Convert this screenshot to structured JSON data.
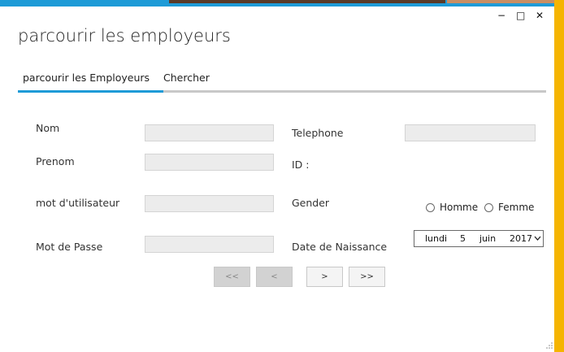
{
  "window": {
    "title": "parcourir les employeurs",
    "minimize": "−",
    "maximize": "□",
    "close": "✕"
  },
  "tabs": [
    {
      "label": "parcourir les Employeurs",
      "active": true
    },
    {
      "label": "Chercher",
      "active": false
    }
  ],
  "form": {
    "nom_label": "Nom",
    "prenom_label": "Prenom",
    "username_label": "mot d'utilisateur",
    "password_label": "Mot de Passe",
    "telephone_label": "Telephone",
    "id_label": "ID :",
    "gender_label": "Gender",
    "gender_options": [
      "Homme",
      "Femme"
    ],
    "birthdate_label": "Date de Naissance",
    "birthdate": {
      "weekday": "lundi",
      "day": "5",
      "month": "juin",
      "year": "2017"
    },
    "nom_value": "",
    "prenom_value": "",
    "username_value": "",
    "password_value": "",
    "telephone_value": ""
  },
  "navigation": {
    "first": "<<",
    "prev": "<",
    "next": ">",
    "last": ">>"
  },
  "colors": {
    "accent": "#1e9bd7",
    "taskbar": "#f5b400"
  }
}
